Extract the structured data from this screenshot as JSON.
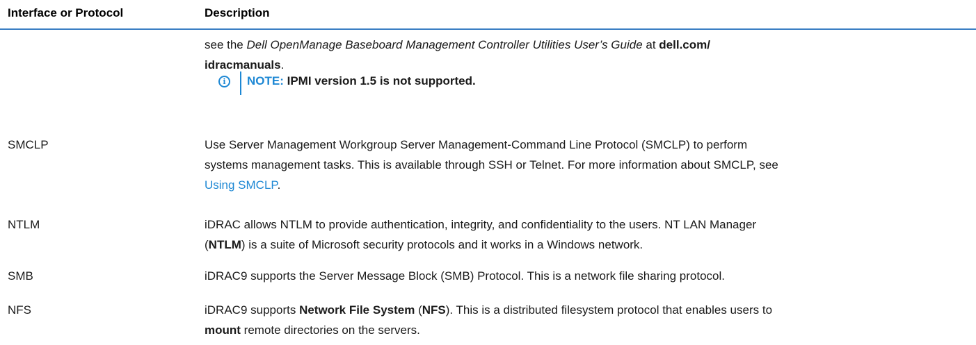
{
  "header": {
    "col1": "Interface or Protocol",
    "col2": "Description"
  },
  "continuation": {
    "line1_pre": "see the ",
    "line1_italic": "Dell OpenManage Baseboard Management Controller Utilities User’s Guide",
    "line1_mid": " at ",
    "line1_bold": "dell.com/",
    "line2_bold": "idracmanuals",
    "line2_post": "."
  },
  "note": {
    "icon": "info-icon",
    "label": "NOTE:",
    "body": " IPMI version 1.5 is not supported."
  },
  "rows": [
    {
      "protocol": "SMCLP",
      "line1": "Use Server Management Workgroup Server Management-Command Line Protocol (SMCLP) to perform",
      "line2": "systems management tasks. This is available through SSH or Telnet. For more information about SMCLP, see",
      "link": "Using SMCLP",
      "link_post": "."
    },
    {
      "protocol": "NTLM",
      "line1": "iDRAC allows NTLM to provide authentication, integrity, and confidentiality to the users. NT LAN Manager",
      "line2_pre": "(",
      "line2_bold": "NTLM",
      "line2_post": ") is a suite of Microsoft security protocols and it works in a Windows network."
    },
    {
      "protocol": "SMB",
      "line1": "iDRAC9 supports the Server Message Block (SMB) Protocol. This is a network file sharing protocol."
    },
    {
      "protocol": "NFS",
      "line1_pre": "iDRAC9 supports ",
      "line1_bold1": "Network File System",
      "line1_mid": " (",
      "line1_bold2": "NFS",
      "line1_post": "). This is a distributed filesystem protocol that enables users to",
      "line2_bold": "mount",
      "line2_post": " remote directories on the servers."
    }
  ]
}
